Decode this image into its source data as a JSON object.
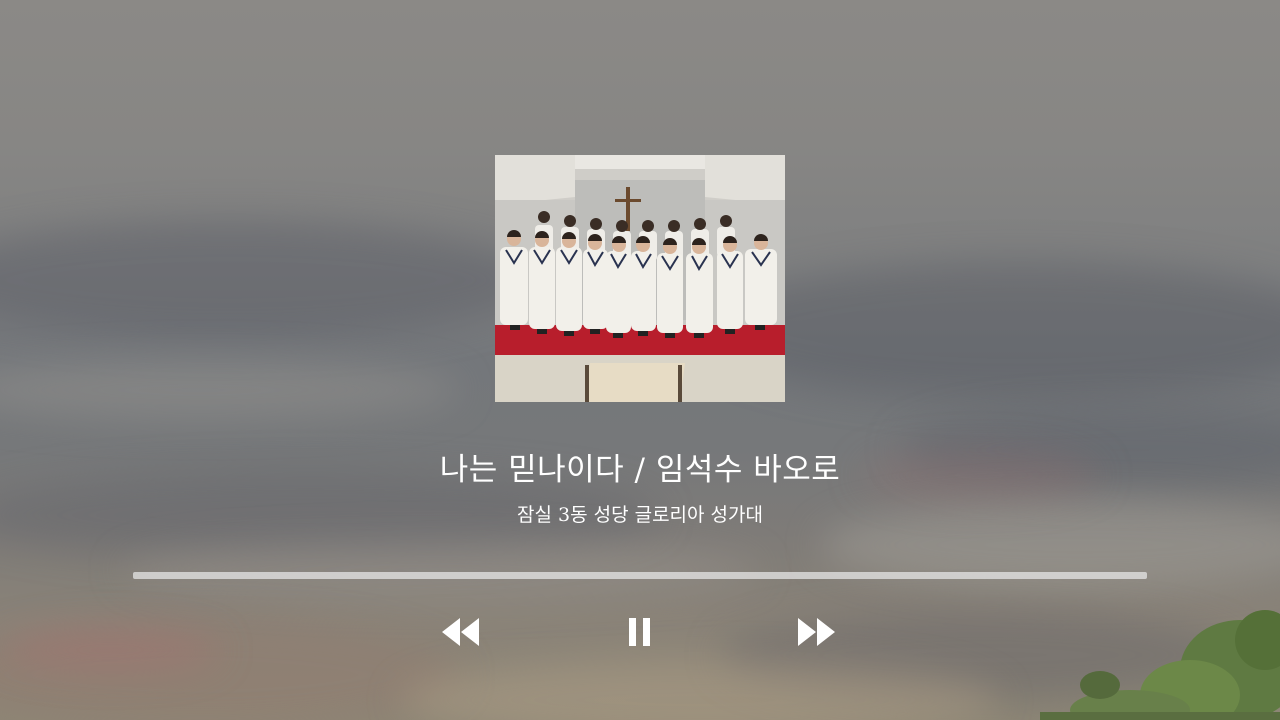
{
  "player": {
    "album_art": "choir-photo",
    "track_title": "나는 믿나이다 / 임석수 바오로",
    "artist": "잠실 3동 성당 글로리아 성가대",
    "progress_fraction": 0.0,
    "controls": {
      "previous_icon": "rewind-icon",
      "play_pause_icon": "pause-icon",
      "next_icon": "fast-forward-icon"
    }
  },
  "colors": {
    "text": "#ffffff",
    "progress_track": "#d9d9d9",
    "choir_robe": "#f2f0ea",
    "carpet": "#b81e2c"
  }
}
